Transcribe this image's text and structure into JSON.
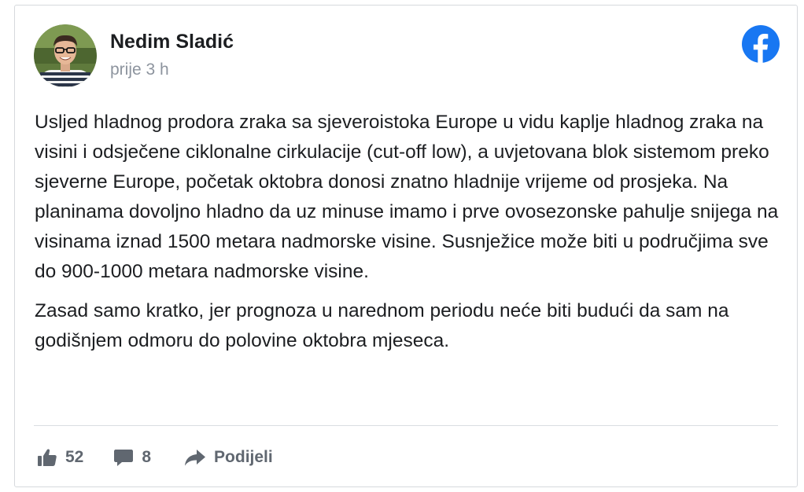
{
  "post": {
    "author": "Nedim Sladić",
    "time": "prije 3 h",
    "paragraphs": [
      "Usljed hladnog prodora zraka sa sjeveroistoka Europe u vidu kaplje hladnog zraka na visini i odsječene ciklonalne cirkulacije (cut-off low), a uvjetovana blok sistemom preko sjeverne Europe, početak oktobra donosi znatno hladnije vrijeme od prosjeka. Na planinama dovoljno hladno da uz minuse imamo i prve ovosezonske pahulje snijega na visinama iznad 1500 metara nadmorske visine. Susnježice može biti u područjima sve do 900-1000 metara nadmorske visine.",
      "Zasad samo kratko, jer prognoza u narednom periodu neće biti budući da sam na godišnjem odmoru do polovine oktobra mjeseca."
    ]
  },
  "actions": {
    "likes": "52",
    "comments": "8",
    "share_label": "Podijeli"
  },
  "icons": {
    "brand": "facebook-logo-icon",
    "like": "thumbs-up-icon",
    "comment": "speech-bubble-icon",
    "share": "share-arrow-icon"
  },
  "colors": {
    "facebook_blue": "#1877f2",
    "text": "#1c1e21",
    "muted": "#8d949e",
    "action": "#606770"
  }
}
